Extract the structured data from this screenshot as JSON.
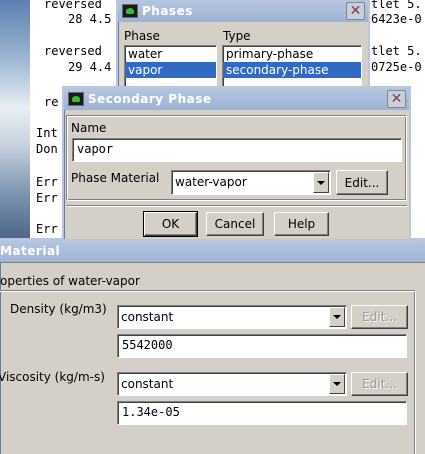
{
  "console": {
    "lines": [
      "reversed",
      "28 4.5",
      "reversed",
      "29 4.4",
      "re",
      "Int",
      "Don",
      "Err",
      "Err",
      "Err"
    ],
    "right_lines": [
      "tlet 5.",
      "6423e-0",
      "tlet 5.",
      "0725e-0"
    ]
  },
  "phases": {
    "title": "Phases",
    "phase_header": "Phase",
    "type_header": "Type",
    "phase_items": [
      "water",
      "vapor"
    ],
    "type_items": [
      "primary-phase",
      "secondary-phase"
    ],
    "selected_index": 1
  },
  "secondary": {
    "title": "Secondary Phase",
    "name_label": "Name",
    "name_value": "vapor",
    "material_label": "Phase Material",
    "material_value": "water-vapor",
    "edit_label": "Edit...",
    "ok_label": "OK",
    "cancel_label": "Cancel",
    "help_label": "Help"
  },
  "material": {
    "title": "Material",
    "section_title": "operties of water-vapor",
    "density_label": "Density (kg/m3)",
    "density_method": "constant",
    "density_value": "5542000",
    "viscosity_label": "Viscosity (kg/m-s)",
    "viscosity_method": "constant",
    "viscosity_value": "1.34e-05",
    "edit_label": "Edit..."
  }
}
